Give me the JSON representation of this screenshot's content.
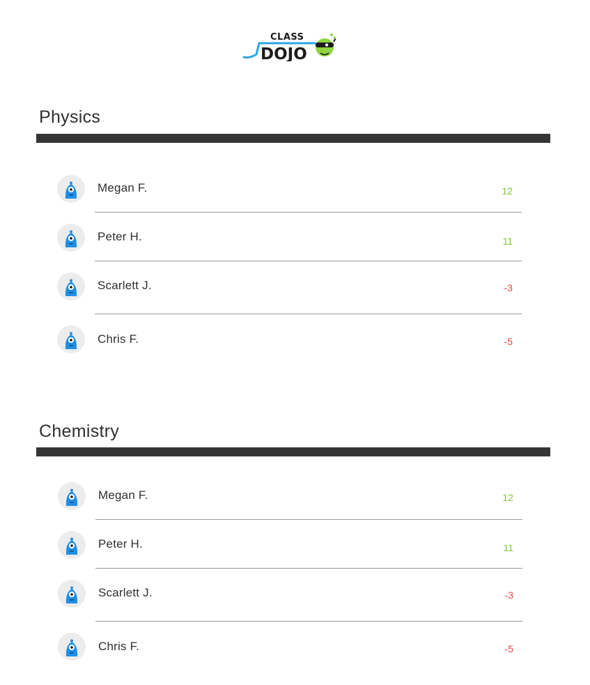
{
  "logo": {
    "line1": "CLASS",
    "line2": "DOJO"
  },
  "colors": {
    "positive": "#7ec83a",
    "negative": "#e2473f",
    "bar": "#353535",
    "avatar_monster": "#1f8fe8"
  },
  "classes": [
    {
      "name": "Physics",
      "students": [
        {
          "name": "Megan F.",
          "points": "12",
          "status": "positive",
          "avatar_icon": "blue-monster-icon"
        },
        {
          "name": "Peter H.",
          "points": "11",
          "status": "positive",
          "avatar_icon": "blue-monster-icon"
        },
        {
          "name": "Scarlett J.",
          "points": "-3",
          "status": "negative",
          "avatar_icon": "blue-monster-icon"
        },
        {
          "name": "Chris F.",
          "points": "-5",
          "status": "negative",
          "avatar_icon": "blue-monster-icon"
        }
      ]
    },
    {
      "name": "Chemistry",
      "students": [
        {
          "name": "Megan F.",
          "points": "12",
          "status": "positive",
          "avatar_icon": "blue-monster-icon"
        },
        {
          "name": "Peter H.",
          "points": "11",
          "status": "positive",
          "avatar_icon": "blue-monster-icon"
        },
        {
          "name": "Scarlett J.",
          "points": "-3",
          "status": "negative",
          "avatar_icon": "blue-monster-icon"
        },
        {
          "name": "Chris F.",
          "points": "-5",
          "status": "negative",
          "avatar_icon": "blue-monster-icon"
        }
      ]
    }
  ]
}
